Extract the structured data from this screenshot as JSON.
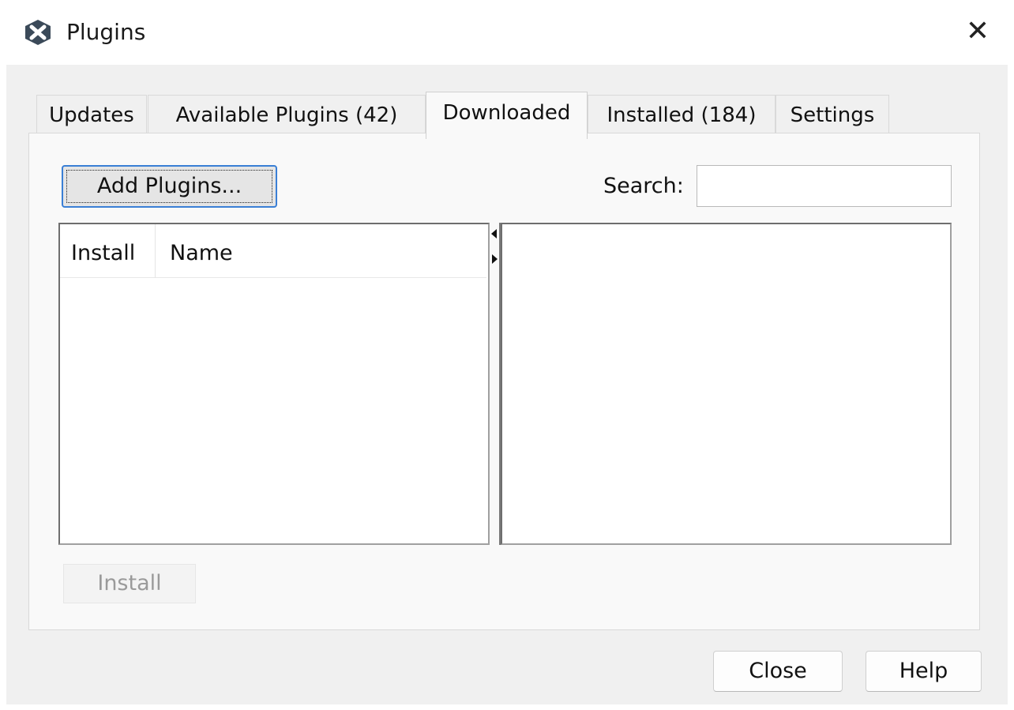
{
  "window": {
    "title": "Plugins",
    "close_glyph": "✕",
    "icon": "app-logo-icon"
  },
  "tabs": [
    {
      "label": "Updates",
      "active": false
    },
    {
      "label": "Available Plugins (42)",
      "active": false
    },
    {
      "label": "Downloaded",
      "active": true
    },
    {
      "label": "Installed (184)",
      "active": false
    },
    {
      "label": "Settings",
      "active": false
    }
  ],
  "toolbar": {
    "add_plugins_label": "Add Plugins...",
    "search_label": "Search:",
    "search_value": ""
  },
  "plugin_list": {
    "columns": [
      "Install",
      "Name"
    ],
    "rows": []
  },
  "actions": {
    "install_label": "Install",
    "install_enabled": false
  },
  "footer": {
    "close_label": "Close",
    "help_label": "Help"
  },
  "colors": {
    "focus_border": "#3a7fd5",
    "dialog_bg": "#f0f0f0",
    "disabled_text": "#9a9a9a"
  }
}
